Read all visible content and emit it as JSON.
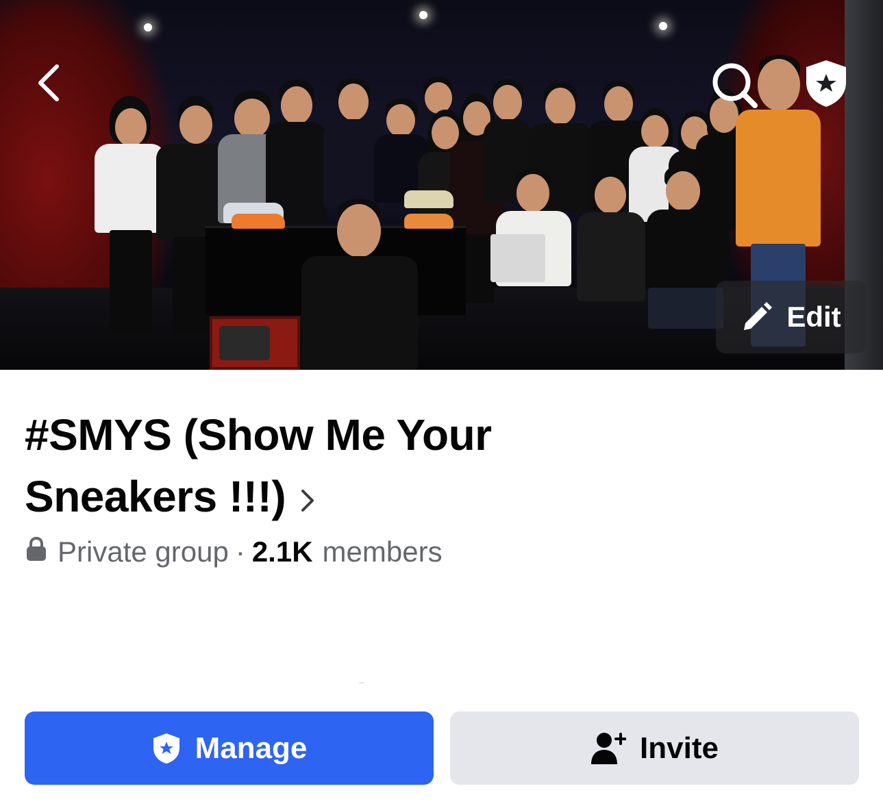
{
  "cover": {
    "image_alt": "group-cover-photo",
    "actions": {
      "back_icon": "chevron-left-icon",
      "search_icon": "search-icon",
      "admin_icon": "admin-shield-icon",
      "edit_icon": "pencil-icon",
      "edit_label": "Edit"
    }
  },
  "group": {
    "name": "#SMYS (Show Me Your Sneakers !!!)",
    "privacy_icon": "lock-icon",
    "privacy": "Private group",
    "separator": "·",
    "member_count": "2.1K",
    "member_label": "members"
  },
  "buttons": {
    "manage": {
      "icon": "admin-shield-icon",
      "label": "Manage"
    },
    "invite": {
      "icon": "add-person-icon",
      "label": "Invite"
    }
  },
  "colors": {
    "primary": "#2d64f2",
    "secondary_bg": "#e4e6eb",
    "text_primary": "#050505",
    "text_secondary": "#65676b"
  }
}
